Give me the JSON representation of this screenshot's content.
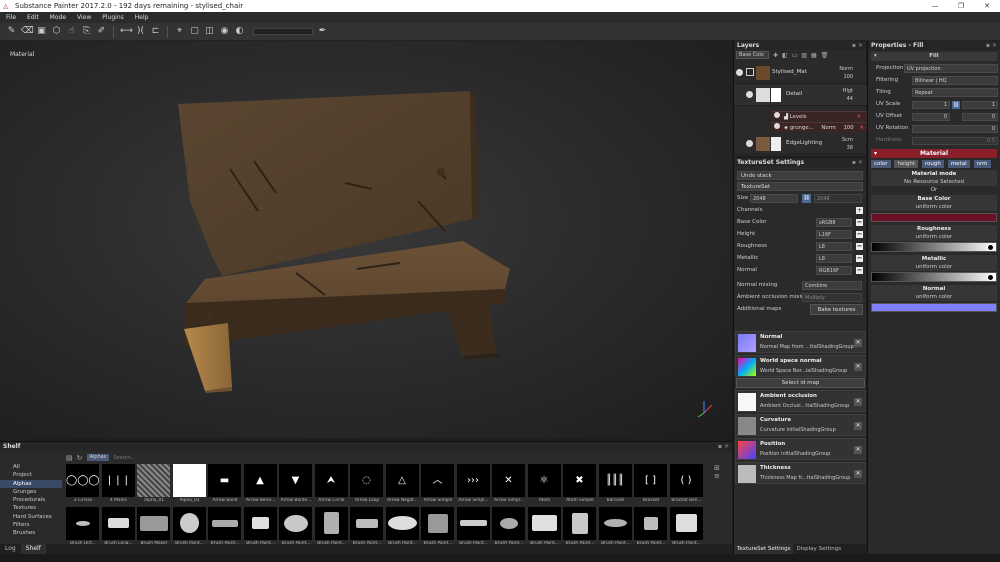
{
  "window": {
    "title": "Substance Painter 2017.2.0 - 192 days remaining - stylised_chair",
    "min": "—",
    "max": "❐",
    "close": "✕"
  },
  "menu": [
    "File",
    "Edit",
    "Mode",
    "View",
    "Plugins",
    "Help"
  ],
  "viewport": {
    "label": "Material"
  },
  "layers": {
    "title": "Layers",
    "channel_select": "Base Colo",
    "items": [
      {
        "name": "Stylised_Mat",
        "blend": "Norm",
        "opacity": "100"
      },
      {
        "name": "Detail",
        "blend": "Hlgt",
        "opacity": "44"
      },
      {
        "name": "Levels"
      },
      {
        "name": "grunge...",
        "blend": "Norm",
        "opacity": "100"
      },
      {
        "name": "EdgeLighting",
        "blend": "Scrn",
        "opacity": "38"
      }
    ]
  },
  "textureset": {
    "title": "TextureSet Settings",
    "undo": "Undo stack",
    "set_name": "TextureSet",
    "size_label": "Size",
    "size_value": "2048",
    "size_value2": "2048",
    "channels_label": "Channels",
    "channels": [
      {
        "name": "Base Color",
        "format": "sRGB8"
      },
      {
        "name": "Height",
        "format": "L16F"
      },
      {
        "name": "Roughness",
        "format": "L8"
      },
      {
        "name": "Metallic",
        "format": "L8"
      },
      {
        "name": "Normal",
        "format": "RGB16F"
      }
    ],
    "normal_mixing_label": "Normal mixing",
    "normal_mixing_value": "Combine",
    "ao_mixing_label": "Ambient occlusion mixing",
    "ao_mixing_value": "Multiply",
    "additional_maps_label": "Additional maps",
    "bake_button": "Bake textures",
    "maps": [
      {
        "name": "Normal",
        "sub": "Normal Map from ...ttalShadingGroup"
      },
      {
        "name": "World space normal",
        "sub": "World Space Nor...ialShadingGroup"
      },
      {
        "name": "Ambient occlusion",
        "sub": "Ambient Occlusi...ttalShadingGroup"
      },
      {
        "name": "Curvature",
        "sub": "Curvature initialShadingGroup"
      },
      {
        "name": "Position",
        "sub": "Position initialShadingGroup"
      },
      {
        "name": "Thickness",
        "sub": "Thickness Map fr...ttalShadingGroup"
      }
    ],
    "select_id_map": "Select id map",
    "tabs": [
      "TextureSet Settings",
      "Display Settings"
    ]
  },
  "properties": {
    "title": "Properties - Fill",
    "fill_header": "Fill",
    "projection_label": "Projection",
    "projection_value": "UV projection",
    "filtering_label": "Filtering",
    "filtering_value": "Bilinear | HQ",
    "tiling_label": "Tiling",
    "tiling_value": "Repeat",
    "uvscale_label": "UV Scale",
    "uvscale_value": "1",
    "uvscale_value2": "1",
    "uvoffset_label": "UV Offset",
    "uvoffset_value": "0",
    "uvoffset_value2": "0",
    "uvrotation_label": "UV Rotation",
    "uvrotation_value": "0",
    "hardness_label": "Hardness",
    "hardness_value": "0.5",
    "material_header": "Material",
    "chips": [
      "color",
      "height",
      "rough",
      "metal",
      "nrm"
    ],
    "material_mode": "Material mode",
    "no_resource": "No Resource Selected",
    "or": "Or",
    "base_color": "Base Color",
    "roughness": "Roughness",
    "metallic": "Metallic",
    "normal": "Normal",
    "uniform": "uniform color",
    "base_color_hex": "#6e1025",
    "normal_hex": "#8080ff"
  },
  "shelf": {
    "title": "Shelf",
    "categories": [
      "All",
      "Project",
      "Alphas",
      "Grunges",
      "Procedurals",
      "Textures",
      "Hard Surfaces",
      "Filters",
      "Brushes"
    ],
    "filter_tag": "Alphas",
    "search_placeholder": "Search...",
    "items": [
      "3 Circles",
      "4 Marks",
      "Alpha_01",
      "Alpha_03",
      "Arrow Band",
      "Arrow Bend...",
      "Arrow Borde...",
      "Arrow Circle",
      "Arrow Loop",
      "Arrow Negat...",
      "Arrow Simple",
      "Arrow Simpl...",
      "Arrow Simpl...",
      "Atom",
      "Atom Simple",
      "Barcode",
      "Bracket",
      "Bracket Ben...",
      "Brush Dirt...",
      "Brush Long...",
      "Brush Maker",
      "Brush Paint...",
      "Brush Paint...",
      "Brush Paint...",
      "Brush Paint...",
      "Brush Paint...",
      "Brush Paint...",
      "Brush Paint...",
      "Brush Paint...",
      "Brush Paint...",
      "Brush Paint...",
      "Brush Paint...",
      "Brush Paint...",
      "Brush Paint...",
      "Brush Paint...",
      "Brush Paint..."
    ]
  },
  "bottom_tabs": [
    "Log",
    "Shelf"
  ]
}
